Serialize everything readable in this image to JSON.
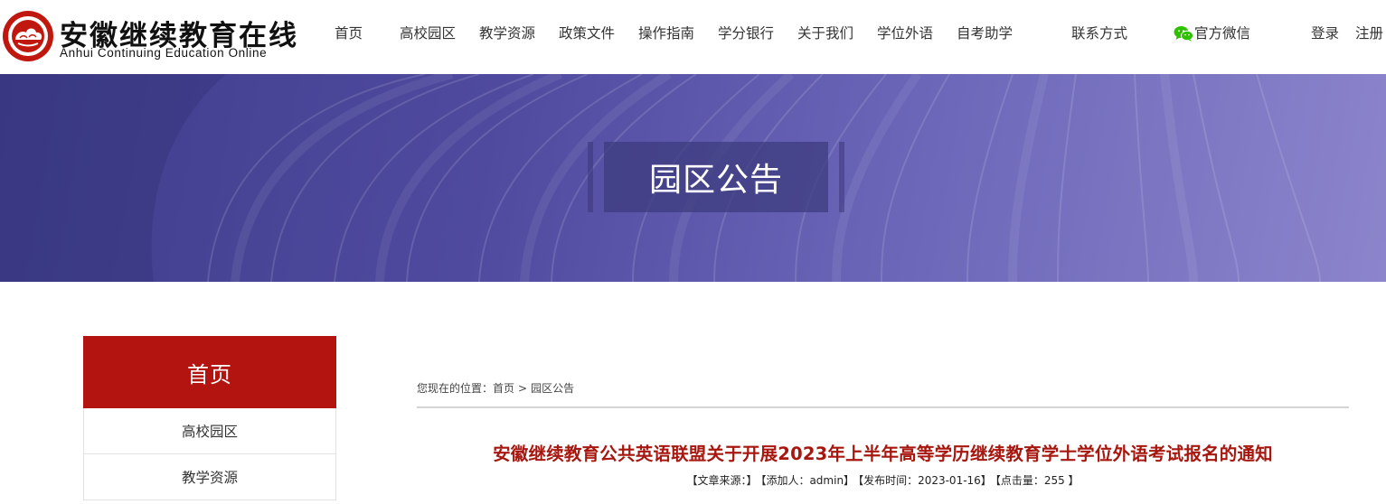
{
  "header": {
    "logo": {
      "title_cn": "安徽继续教育在线",
      "title_en": "Anhui Continuing Education Online",
      "seal_icon": "red-cloud-seal-icon"
    },
    "nav": [
      {
        "label": "首页"
      },
      {
        "label": "高校园区"
      },
      {
        "label": "教学资源"
      },
      {
        "label": "政策文件"
      },
      {
        "label": "操作指南"
      },
      {
        "label": "学分银行"
      },
      {
        "label": "关于我们"
      },
      {
        "label": "学位外语"
      },
      {
        "label": "自考助学"
      },
      {
        "label": "联系方式"
      }
    ],
    "wechat": {
      "label": "官方微信",
      "icon": "wechat-icon",
      "color": "#2dc100"
    },
    "login": "登录",
    "register": "注册"
  },
  "banner": {
    "title": "园区公告"
  },
  "sidebar": {
    "head": "首页",
    "items": [
      {
        "label": "高校园区"
      },
      {
        "label": "教学资源"
      }
    ]
  },
  "breadcrumb": {
    "prefix": "您现在的位置：",
    "home": "首页",
    "separator": ">",
    "current": "园区公告"
  },
  "article": {
    "title": "安徽继续教育公共英语联盟关于开展2023年上半年高等学历继续教育学士学位外语考试报名的通知",
    "meta": {
      "source": "【文章来源：】",
      "author": "【添加人：admin】",
      "published": "【发布时间：2023-01-16】",
      "views": "【点击量：255 】"
    }
  },
  "colors": {
    "brand_red": "#b3140f",
    "title_red": "#a7170f",
    "banner_purple": "#4f4a9e"
  }
}
